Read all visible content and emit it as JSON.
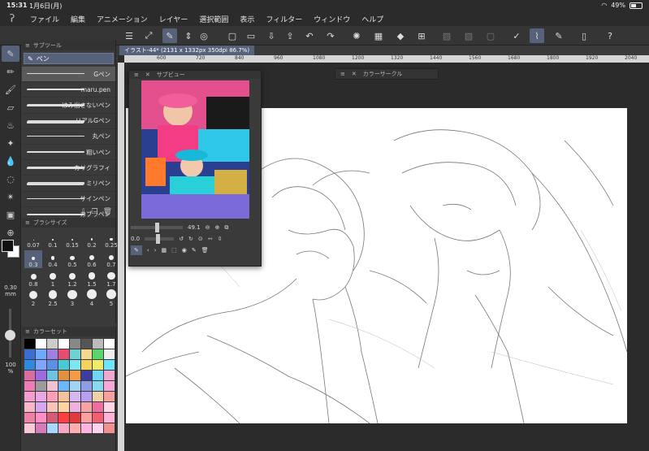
{
  "status": {
    "time": "15:31",
    "date": "1月6日(月)",
    "battery": "49%"
  },
  "menu": [
    "ファイル",
    "編集",
    "アニメーション",
    "レイヤー",
    "選択範囲",
    "表示",
    "フィルター",
    "ウィンドウ",
    "ヘルプ"
  ],
  "subtool": {
    "title": "サブツール",
    "tab": "ペン",
    "brushes": [
      "Gペン",
      "maru.pen",
      "はみ出さないペン",
      "リアルGペン",
      "丸ペン",
      "粗いペン",
      "カリグラフィ",
      "ミリペン",
      "サインペン",
      "カブラペン"
    ]
  },
  "brushsize": {
    "title": "ブラシサイズ",
    "sizes": [
      "0.07",
      "0.1",
      "0.15",
      "0.2",
      "0.25",
      "0.3",
      "0.4",
      "0.5",
      "0.6",
      "0.7",
      "0.8",
      "1",
      "1.2",
      "1.5",
      "1.7",
      "2",
      "2.5",
      "3",
      "4",
      "5"
    ]
  },
  "colorset": {
    "title": "カラーセット"
  },
  "left": {
    "size_value": "0.30",
    "size_unit": "mm",
    "opacity": "100",
    "opacity_unit": "%"
  },
  "document": {
    "tab": "イラスト-44* (2131 x 1332px 350dpi 86.7%)"
  },
  "ruler": [
    "600",
    "720",
    "840",
    "960",
    "1080",
    "1200",
    "1320",
    "1440",
    "1560",
    "1680",
    "1800",
    "1920",
    "2040"
  ],
  "subview": {
    "title": "サブビュー",
    "zoom": "49.1",
    "rotation": "0.0"
  },
  "colorcircle": {
    "title": "カラーサークル"
  },
  "colors": {
    "accent": "#56627a",
    "panel": "#3a3a3a",
    "swatches": [
      "#000000",
      "#ffffff",
      "#cccccc",
      "#ffffff",
      "#888888",
      "#555555",
      "#bbbbbb",
      "#ffffff",
      "#3b6ed1",
      "#6fa8ff",
      "#9f7fe0",
      "#e54d6e",
      "#6fd0d5",
      "#f2d98f",
      "#5ad46d",
      "#eeeeee",
      "#2e8ae0",
      "#7fa5ff",
      "#5d8fe8",
      "#48c9d4",
      "#7de7f0",
      "#f5d35a",
      "#f0ec6b",
      "#6de5ff",
      "#d86d9f",
      "#9e6ae0",
      "#6cc4e0",
      "#e48f40",
      "#f39b49",
      "#3d3d9d",
      "#6ed7f7",
      "#f0a7d0",
      "#f07cb5",
      "#9c9c9c",
      "#f0c3d3",
      "#6ab7ff",
      "#a0d4f2",
      "#8e9de5",
      "#8ad8f0",
      "#f7a7d8",
      "#f29fcb",
      "#e9a7e6",
      "#ff9fb8",
      "#f5c19c",
      "#d7b7f0",
      "#b8a0f0",
      "#f0d0a8",
      "#f6a0a0",
      "#f8b7c6",
      "#d5a8f0",
      "#f7c4b8",
      "#ffd4a0",
      "#f0b0e0",
      "#f5a3a3",
      "#ed6ea0",
      "#ffd6e8",
      "#ee82a5",
      "#ff8fc4",
      "#d35c77",
      "#ff3f3f",
      "#e23b3b",
      "#ff9f9f",
      "#f06070",
      "#ffb3d9",
      "#f9c7d8",
      "#d87ab8",
      "#a8d8ff",
      "#f4a8c4",
      "#ffafaf",
      "#ffb5e0",
      "#fbd5f0",
      "#f09090"
    ]
  }
}
